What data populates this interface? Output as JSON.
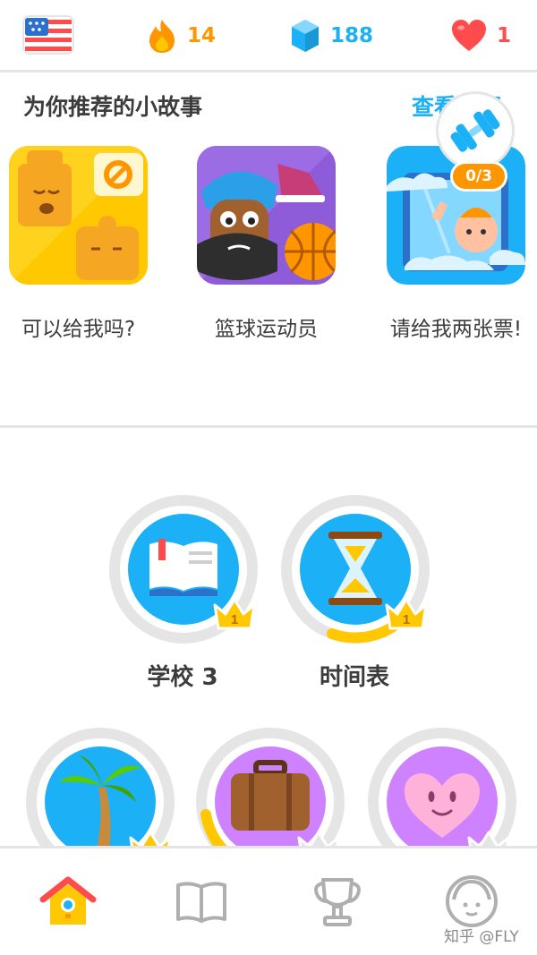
{
  "header": {
    "flag_icon": "us-flag-icon",
    "streak": {
      "icon": "flame-icon",
      "count": "14",
      "color": "#ff9600"
    },
    "gems": {
      "icon": "gem-icon",
      "count": "188",
      "color": "#1cb0f6"
    },
    "hearts": {
      "icon": "heart-icon",
      "count": "1",
      "color": "#ff4b4b"
    }
  },
  "stories": {
    "title": "为你推荐的小故事",
    "view_all": "查看全部",
    "practice": {
      "icon": "dumbbell-icon",
      "progress": "0/3"
    },
    "items": [
      {
        "label": "可以给我吗?"
      },
      {
        "label": "篮球运动员"
      },
      {
        "label": "请给我两张票!"
      }
    ]
  },
  "skills": {
    "row1": [
      {
        "label": "学校 3",
        "icon": "book-icon",
        "crown_level": "1",
        "progress": 0
      },
      {
        "label": "时间表",
        "icon": "hourglass-icon",
        "crown_level": "1",
        "progress": 0.15
      }
    ],
    "row2": [
      {
        "icon": "palm-tree-icon",
        "crown_level": "1"
      },
      {
        "icon": "suitcase-icon",
        "crown_level": ""
      },
      {
        "icon": "heart-face-icon",
        "crown_level": ""
      }
    ]
  },
  "nav": {
    "items": [
      "home-icon",
      "book-icon",
      "trophy-icon",
      "profile-icon"
    ]
  },
  "watermark": "知乎 @FLY"
}
